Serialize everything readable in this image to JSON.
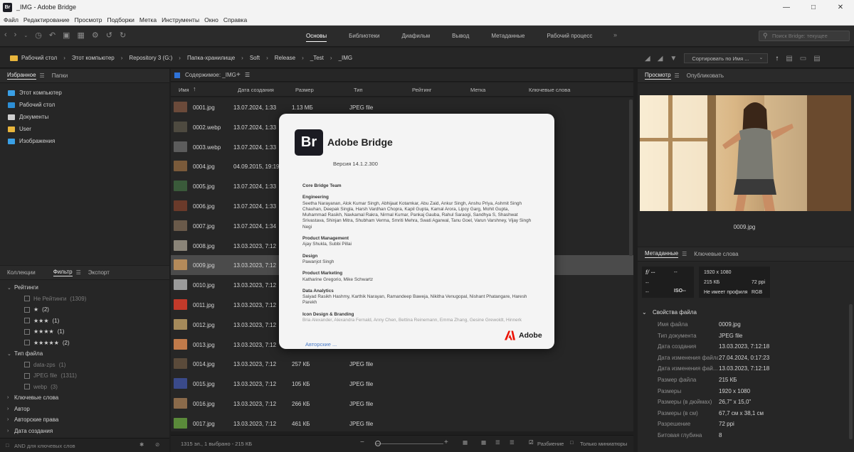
{
  "window": {
    "title": "_IMG - Adobe Bridge",
    "logo": "Br"
  },
  "menu": [
    "Файл",
    "Редактирование",
    "Просмотр",
    "Подборки",
    "Метка",
    "Инструменты",
    "Окно",
    "Справка"
  ],
  "workspaces": {
    "items": [
      "Основы",
      "Библиотеки",
      "Диафильм",
      "Вывод",
      "Метаданные",
      "Рабочий процесс"
    ],
    "active": "Основы",
    "more": "»"
  },
  "search": {
    "placeholder": "Поиск Bridge: текущее"
  },
  "breadcrumb": [
    "Рабочий стол",
    "Этот компьютер",
    "Repository 3 (G:)",
    "Папка-хранилище",
    "Soft",
    "Release",
    "_Test",
    "_IMG"
  ],
  "sort": {
    "label": "Сортировать по Имя ..."
  },
  "favorites": {
    "tabs": [
      "Избранное",
      "Папки"
    ],
    "items": [
      {
        "label": "Этот компьютер",
        "color": "#3aa0e6"
      },
      {
        "label": "Рабочий стол",
        "color": "#2d8fd6"
      },
      {
        "label": "Документы",
        "color": "#cfcfcf"
      },
      {
        "label": "User",
        "color": "#e8b53c"
      },
      {
        "label": "Изображения",
        "color": "#3aa0e6"
      }
    ]
  },
  "filter": {
    "tabs": [
      "Коллекции",
      "Фильтр",
      "Экспорт"
    ],
    "sections": {
      "ratings": {
        "label": "Рейтинги",
        "rows": [
          {
            "label": "Не Рейтинги",
            "count": "(1309)",
            "dim": true
          },
          {
            "label": "★",
            "count": "(2)"
          },
          {
            "label": "★★★",
            "count": "(1)"
          },
          {
            "label": "★★★★",
            "count": "(1)"
          },
          {
            "label": "★★★★★",
            "count": "(2)"
          }
        ]
      },
      "filetype": {
        "label": "Тип файла",
        "rows": [
          {
            "label": "data-zps",
            "count": "(1)",
            "dim": true
          },
          {
            "label": "JPEG file",
            "count": "(1311)",
            "dim": true
          },
          {
            "label": "webp",
            "count": "(3)",
            "dim": true
          }
        ]
      },
      "collapsed": [
        "Ключевые слова",
        "Автор",
        "Авторские права",
        "Дата создания"
      ]
    },
    "footer": "AND для ключевых слов"
  },
  "content": {
    "header": "Содержимое: _IMG",
    "plus": "+",
    "columns": [
      "Имя",
      "Дата создания",
      "Размер",
      "Тип",
      "Рейтинг",
      "Метка",
      "Ключевые слова"
    ],
    "files": [
      {
        "name": "0001.jpg",
        "date": "13.07.2024, 1:33",
        "size": "1.13 МБ",
        "type": "JPEG file",
        "thumb": "#6b4a3a"
      },
      {
        "name": "0002.webp",
        "date": "13.07.2024, 1:33",
        "size": "",
        "type": "",
        "thumb": "#4e4a40"
      },
      {
        "name": "0003.webp",
        "date": "13.07.2024, 1:33",
        "size": "",
        "type": "",
        "thumb": "#5c5c5c"
      },
      {
        "name": "0004.jpg",
        "date": "04.09.2015, 19:19",
        "size": "",
        "type": "",
        "thumb": "#7a5a3a"
      },
      {
        "name": "0005.jpg",
        "date": "13.07.2024, 1:33",
        "size": "",
        "type": "",
        "thumb": "#3a5a3a"
      },
      {
        "name": "0006.jpg",
        "date": "13.07.2024, 1:33",
        "size": "",
        "type": "",
        "thumb": "#6a3a2a"
      },
      {
        "name": "0007.jpg",
        "date": "13.07.2024, 1:34",
        "size": "",
        "type": "",
        "thumb": "#6a5a4a"
      },
      {
        "name": "0008.jpg",
        "date": "13.03.2023, 7:12",
        "size": "",
        "type": "",
        "thumb": "#8a8478"
      },
      {
        "name": "0009.jpg",
        "date": "13.03.2023, 7:12",
        "size": "",
        "type": "",
        "thumb": "#b48a5a",
        "selected": true
      },
      {
        "name": "0010.jpg",
        "date": "13.03.2023, 7:12",
        "size": "",
        "type": "",
        "thumb": "#9a9a9a"
      },
      {
        "name": "0011.jpg",
        "date": "13.03.2023, 7:12",
        "size": "",
        "type": "",
        "thumb": "#c23a2a"
      },
      {
        "name": "0012.jpg",
        "date": "13.03.2023, 7:12",
        "size": "",
        "type": "",
        "thumb": "#a58a5a"
      },
      {
        "name": "0013.jpg",
        "date": "13.03.2023, 7:12",
        "size": "",
        "type": "",
        "thumb": "#c07a4a"
      },
      {
        "name": "0014.jpg",
        "date": "13.03.2023, 7:12",
        "size": "257 КБ",
        "type": "JPEG file",
        "thumb": "#5a4a3a"
      },
      {
        "name": "0015.jpg",
        "date": "13.03.2023, 7:12",
        "size": "105 КБ",
        "type": "JPEG file",
        "thumb": "#3a4a8a"
      },
      {
        "name": "0016.jpg",
        "date": "13.03.2023, 7:12",
        "size": "266 КБ",
        "type": "JPEG file",
        "thumb": "#8a6a4a"
      },
      {
        "name": "0017.jpg",
        "date": "13.03.2023, 7:12",
        "size": "461 КБ",
        "type": "JPEG file",
        "thumb": "#5a8a3a"
      }
    ],
    "status": "1315 эл., 1 выбрано - 215 КБ"
  },
  "view_options": {
    "split": "Разбиение",
    "thumbs_only": "Только миниатюры"
  },
  "about": {
    "logo": "Br",
    "app": "Adobe Bridge",
    "version": "Версия 14.1.2.300",
    "team": "Core Bridge Team",
    "sections": [
      {
        "head": "Engineering",
        "text": "Seetha Narayanan, Alok Kumar Singh, Abhijaat Kotamkar, Abu Zaid, Ankur Singh, Anshu Priya, Ashmit Singh Chauhan, Deepak Singla, Harsh Vardhan Chopra, Kapil Gupta, Kamal Arora, Lipcy Garg, Mohit Gupta, Muhammad Rasikh, Navkamal Rakra, Nirmal Kumar, Pankaj Gauba, Rahul Saraogi, Sandhya S, Shashwat Srivastava, Shinjan Mitra, Shubham Verma, Smriti Mehra, Swati Agarwal, Tanu Goel, Varun Varshney, Vijay Singh Negi"
      },
      {
        "head": "Product Management",
        "text": "Ajay Shukla, Subbi Pillai"
      },
      {
        "head": "Design",
        "text": "Pawanjot Singh"
      },
      {
        "head": "Product Marketing",
        "text": "Katharine Gregorio, Mike Schwartz"
      },
      {
        "head": "Data Analytics",
        "text": "Saiyad Rasikh Hashmy, Karthik Narayan, Ramandeep Baweja, Nikitha Venugopal, Nishant Phatangare, Haresh Parekh"
      },
      {
        "head": "Icon Design & Branding",
        "text": "Bria Alexander, Alexandra Fernald, Anny Chen, Bettina Reinemann, Emma Zhang, Gesine Grewoldt, Hinnerk"
      }
    ],
    "authors_link": "Авторские ...",
    "brand": "Adobe"
  },
  "preview": {
    "tabs": [
      "Просмотр",
      "Опубликовать"
    ],
    "caption": "0009.jpg"
  },
  "metadata": {
    "tabs": [
      "Метаданные",
      "Ключевые слова"
    ],
    "box1": {
      "aperture": "f/ --",
      "shutter": "--",
      "a": "--",
      "b": "--",
      "iso": "ISO--"
    },
    "box2": {
      "dims": "1920 x 1080",
      "size": "215 КБ",
      "ppi": "72 ppi",
      "profile": "Не имеет профиля",
      "mode": "RGB"
    },
    "props_head": "Свойства файла",
    "props": [
      {
        "k": "Имя файла",
        "v": "0009.jpg"
      },
      {
        "k": "Тип документа",
        "v": "JPEG file"
      },
      {
        "k": "Дата создания",
        "v": "13.03.2023, 7:12:18"
      },
      {
        "k": "Дата изменения файла",
        "v": "27.04.2024, 0:17:23"
      },
      {
        "k": "Дата изменения фай...",
        "v": "13.03.2023, 7:12:18"
      },
      {
        "k": "Размер файла",
        "v": "215 КБ"
      },
      {
        "k": "Размеры",
        "v": "1920 x 1080"
      },
      {
        "k": "Размеры (в дюймах)",
        "v": "26,7\" x 15,0\""
      },
      {
        "k": "Размеры (в см)",
        "v": "67,7 см x 38,1 см"
      },
      {
        "k": "Разрешение",
        "v": "72 ppi"
      },
      {
        "k": "Битовая глубина",
        "v": "8"
      }
    ]
  },
  "accent": "#2f73d8",
  "adobe_red": "#eb1000"
}
